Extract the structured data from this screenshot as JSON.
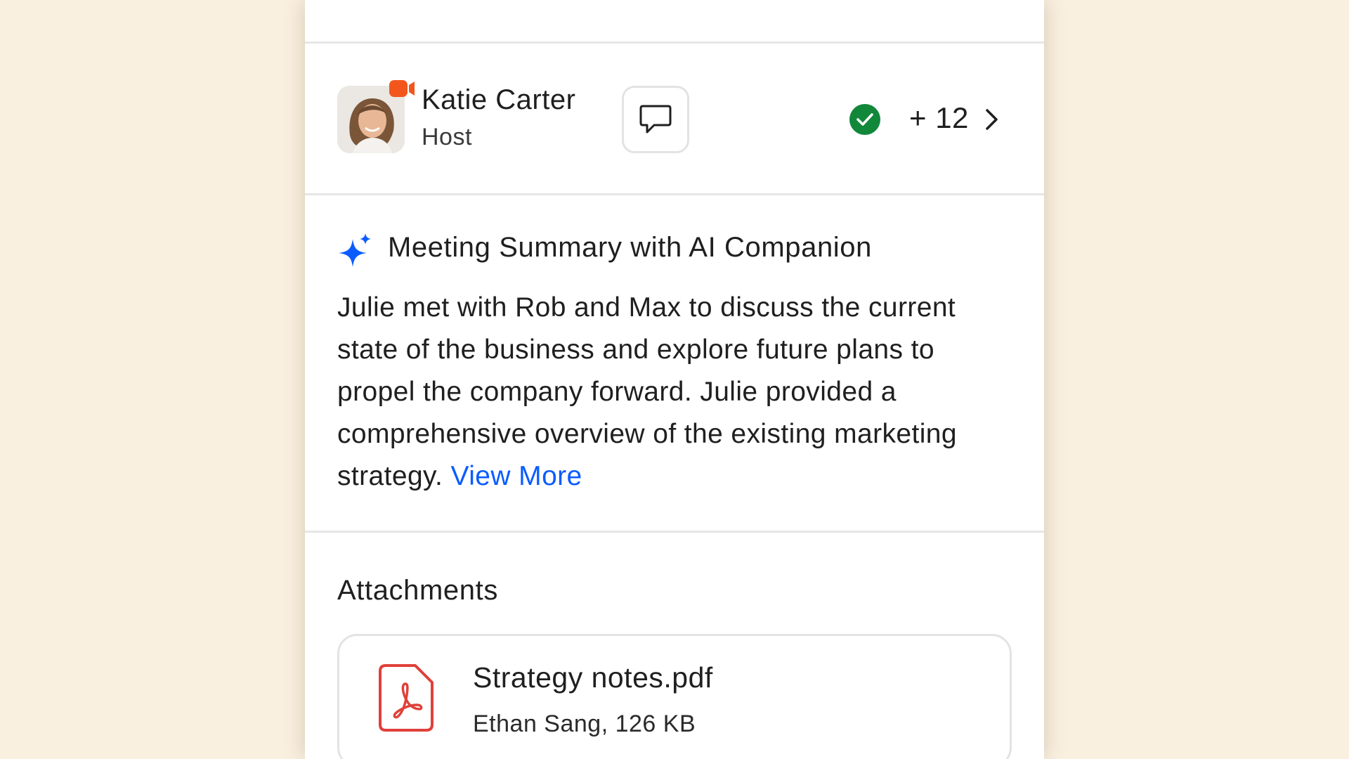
{
  "colors": {
    "background": "#FAF0E0",
    "card": "#FFFFFF",
    "link": "#0B5CFF",
    "success": "#11873A",
    "video_badge": "#F2561D",
    "pdf_red": "#E0403A",
    "divider": "#E6E6E6"
  },
  "host": {
    "name": "Katie Carter",
    "role": "Host",
    "avatar_icon": "avatar-photo",
    "badge_icon": "video-camera-icon",
    "chat_icon": "chat-bubble-icon",
    "status_icon": "check-circle-icon",
    "participant_count": "+ 12",
    "chevron_icon": "chevron-right-icon"
  },
  "summary": {
    "icon": "sparkle-icon",
    "title": "Meeting Summary with AI Companion",
    "body": "Julie met with Rob and Max to discuss the current state of the business and explore future plans to propel the company forward. Julie provided a comprehensive overview of the existing marketing strategy. ",
    "view_more": "View More"
  },
  "attachments": {
    "title": "Attachments",
    "items": [
      {
        "icon": "pdf-file-icon",
        "name": "Strategy notes.pdf",
        "meta": "Ethan Sang, 126 KB"
      }
    ]
  }
}
